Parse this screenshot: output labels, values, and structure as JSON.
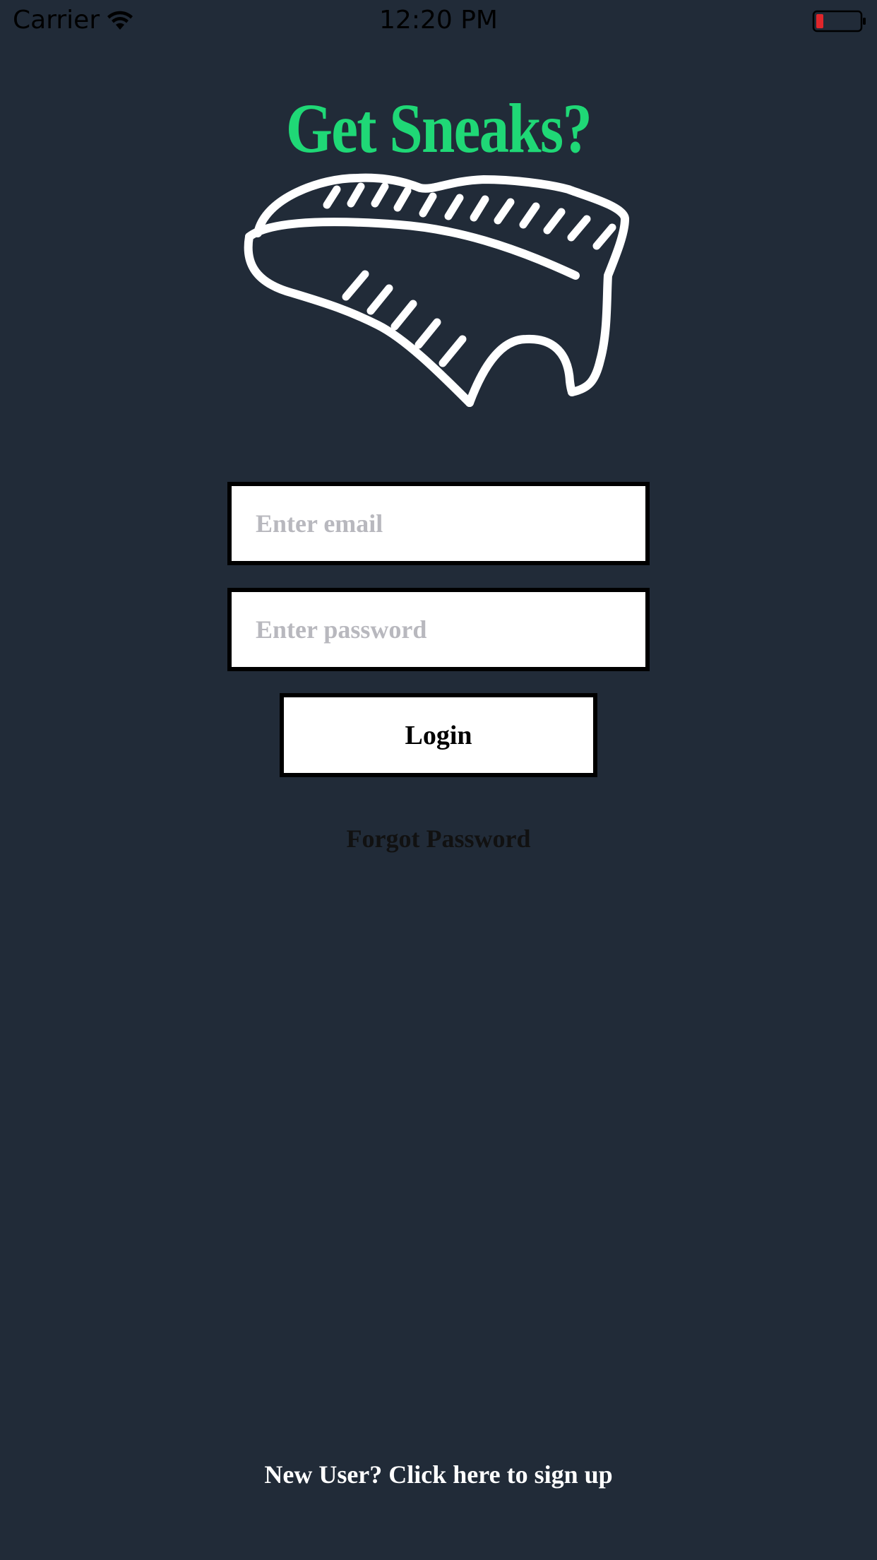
{
  "status_bar": {
    "carrier": "Carrier",
    "time": "12:20 PM",
    "wifi_icon": "wifi-icon",
    "battery_icon": "battery-low-icon",
    "battery_color": "#e0262b"
  },
  "header": {
    "title": "Get Sneaks?",
    "title_color": "#1fd876",
    "logo_icon": "sneaker-icon"
  },
  "login_form": {
    "email_placeholder": "Enter email",
    "email_value": "",
    "password_placeholder": "Enter password",
    "password_value": "",
    "login_label": "Login",
    "forgot_label": "Forgot Password"
  },
  "footer": {
    "signup_label": "New User? Click here to sign up"
  },
  "colors": {
    "background": "#212b38",
    "accent": "#1fd876"
  }
}
